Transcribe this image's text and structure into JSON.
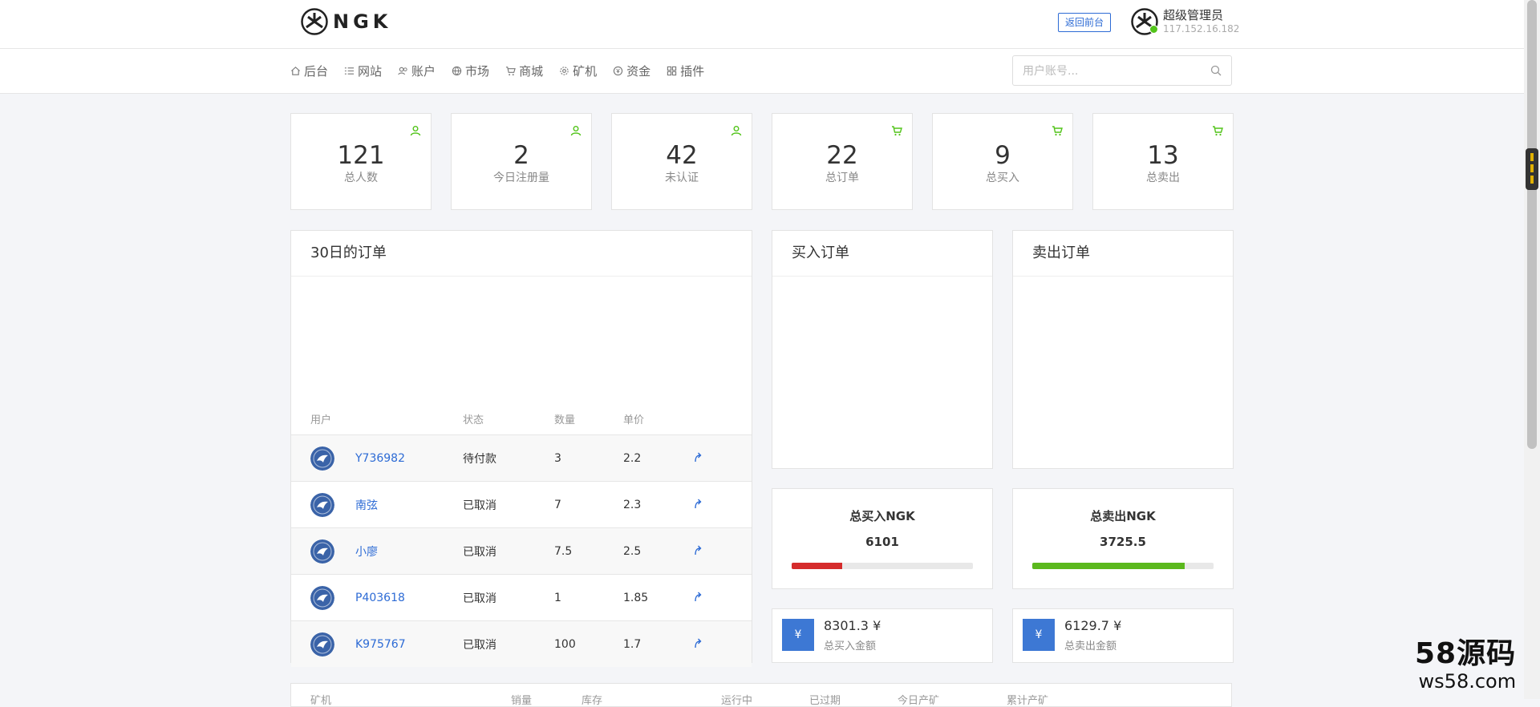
{
  "header": {
    "brand": "NGK",
    "back_button": "返回前台",
    "user_name": "超级管理员",
    "user_ip": "117.152.16.182"
  },
  "nav": {
    "items": [
      {
        "label": "后台",
        "icon": "home-icon"
      },
      {
        "label": "网站",
        "icon": "list-icon"
      },
      {
        "label": "账户",
        "icon": "users-icon"
      },
      {
        "label": "市场",
        "icon": "globe-icon"
      },
      {
        "label": "商城",
        "icon": "cart-icon"
      },
      {
        "label": "矿机",
        "icon": "gear-icon"
      },
      {
        "label": "资金",
        "icon": "coin-icon"
      },
      {
        "label": "插件",
        "icon": "grid-icon"
      }
    ],
    "search_placeholder": "用户账号..."
  },
  "stats": [
    {
      "value": "121",
      "label": "总人数",
      "icon": "user-icon"
    },
    {
      "value": "2",
      "label": "今日注册量",
      "icon": "user-icon"
    },
    {
      "value": "42",
      "label": "未认证",
      "icon": "user-icon"
    },
    {
      "value": "22",
      "label": "总订单",
      "icon": "cart-icon"
    },
    {
      "value": "9",
      "label": "总买入",
      "icon": "cart-icon"
    },
    {
      "value": "13",
      "label": "总卖出",
      "icon": "cart-icon"
    }
  ],
  "orders_panel": {
    "title": "30日的订单",
    "columns": [
      "用户",
      "状态",
      "数量",
      "单价"
    ],
    "rows": [
      {
        "user": "Y736982",
        "status": "待付款",
        "qty": "3",
        "price": "2.2"
      },
      {
        "user": "南弦",
        "status": "已取消",
        "qty": "7",
        "price": "2.3"
      },
      {
        "user": "小廖",
        "status": "已取消",
        "qty": "7.5",
        "price": "2.5"
      },
      {
        "user": "P403618",
        "status": "已取消",
        "qty": "1",
        "price": "1.85"
      },
      {
        "user": "K975767",
        "status": "已取消",
        "qty": "100",
        "price": "1.7"
      }
    ]
  },
  "buy_panel": {
    "title": "买入订单"
  },
  "sell_panel": {
    "title": "卖出订单"
  },
  "totals": {
    "buy": {
      "title": "总买入NGK",
      "value": "6101",
      "progress": 0.28,
      "color": "#d52b2b"
    },
    "sell": {
      "title": "总卖出NGK",
      "value": "3725.5",
      "progress": 0.84,
      "color": "#5bb81d"
    }
  },
  "amounts": {
    "buy": {
      "symbol": "¥",
      "value": "8301.3 ¥",
      "label": "总买入金额"
    },
    "sell": {
      "symbol": "¥",
      "value": "6129.7 ¥",
      "label": "总卖出金额"
    }
  },
  "bottom_table": {
    "columns": [
      "矿机",
      "销量",
      "库存",
      "运行中",
      "已过期",
      "今日产矿",
      "累计产矿"
    ]
  },
  "watermark": {
    "line1": "58源码",
    "line2": "ws58.com"
  },
  "colors": {
    "accent": "#2d6bd5",
    "badge": "#3d78d4",
    "icon_green": "#52c41a"
  }
}
